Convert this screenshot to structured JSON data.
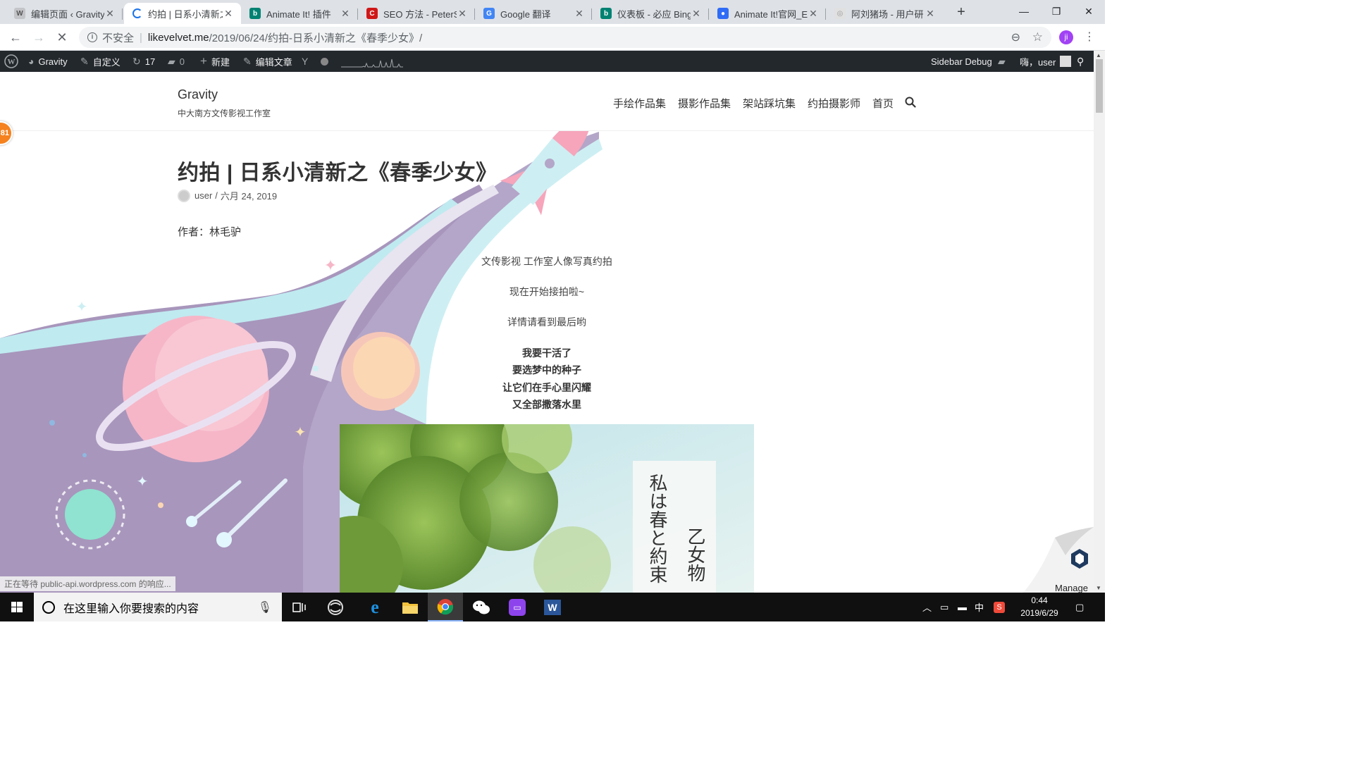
{
  "browser": {
    "tabs": [
      {
        "title": "编辑页面 ‹ Gravity",
        "close": "✕"
      },
      {
        "title": "约拍 | 日系小清新之",
        "close": "✕"
      },
      {
        "title": "Animate It!  插件",
        "close": "✕"
      },
      {
        "title": "SEO 方法 - PeterS",
        "close": "✕"
      },
      {
        "title": "Google 翻译",
        "close": "✕"
      },
      {
        "title": "仪表板 - 必应 Bing",
        "close": "✕"
      },
      {
        "title": "Animate It!官网_E",
        "close": "✕"
      },
      {
        "title": "阿刘猪场 - 用户研",
        "close": "✕"
      }
    ],
    "new_tab": "+",
    "window": {
      "minimize": "—",
      "restore": "❐",
      "close": "✕"
    },
    "address": {
      "insecure": "不安全",
      "host": "likevelvet.me",
      "path": "/2019/06/24/约拍-日系小清新之《春季少女》/"
    },
    "profile_initial": "ji"
  },
  "adminbar": {
    "site": "Gravity",
    "customize": "自定义",
    "updates": "17",
    "comments": "0",
    "new": "新建",
    "edit": "编辑文章",
    "sidebar_debug": "Sidebar Debug",
    "greeting": "嗨，user"
  },
  "site": {
    "title": "Gravity",
    "description": "中大南方文传影视工作室",
    "nav": [
      "手绘作品集",
      "摄影作品集",
      "架站踩坑集",
      "约拍摄影师",
      "首页"
    ]
  },
  "post": {
    "title": "约拍 | 日系小清新之《春季少女》",
    "author": "user",
    "date_sep": "/",
    "date": "六月 24, 2019",
    "author_line": "作者：林毛驴",
    "lines": [
      "文传影视 工作室人像写真约拍",
      "现在开始接拍啦~",
      "详情请看到最后哟"
    ],
    "bold_lines": [
      "我要干活了",
      "要选梦中的种子",
      "让它们在手心里闪耀",
      "又全部撒落水里"
    ],
    "photo_text_1": "私は春と約束",
    "photo_text_2": "乙女物"
  },
  "badge": "81",
  "status_text": "正在等待 public-api.wordpress.com 的响应...",
  "manage_label": "Manage",
  "taskbar": {
    "search_placeholder": "在这里输入你要搜索的内容",
    "ime": "中",
    "time": "0:44",
    "date": "2019/6/29"
  },
  "colors": {
    "adminbar": "#23282d",
    "tab_strip": "#dee1e6",
    "accent_purple": "#a142f4",
    "badge_orange": "#f5821f"
  }
}
